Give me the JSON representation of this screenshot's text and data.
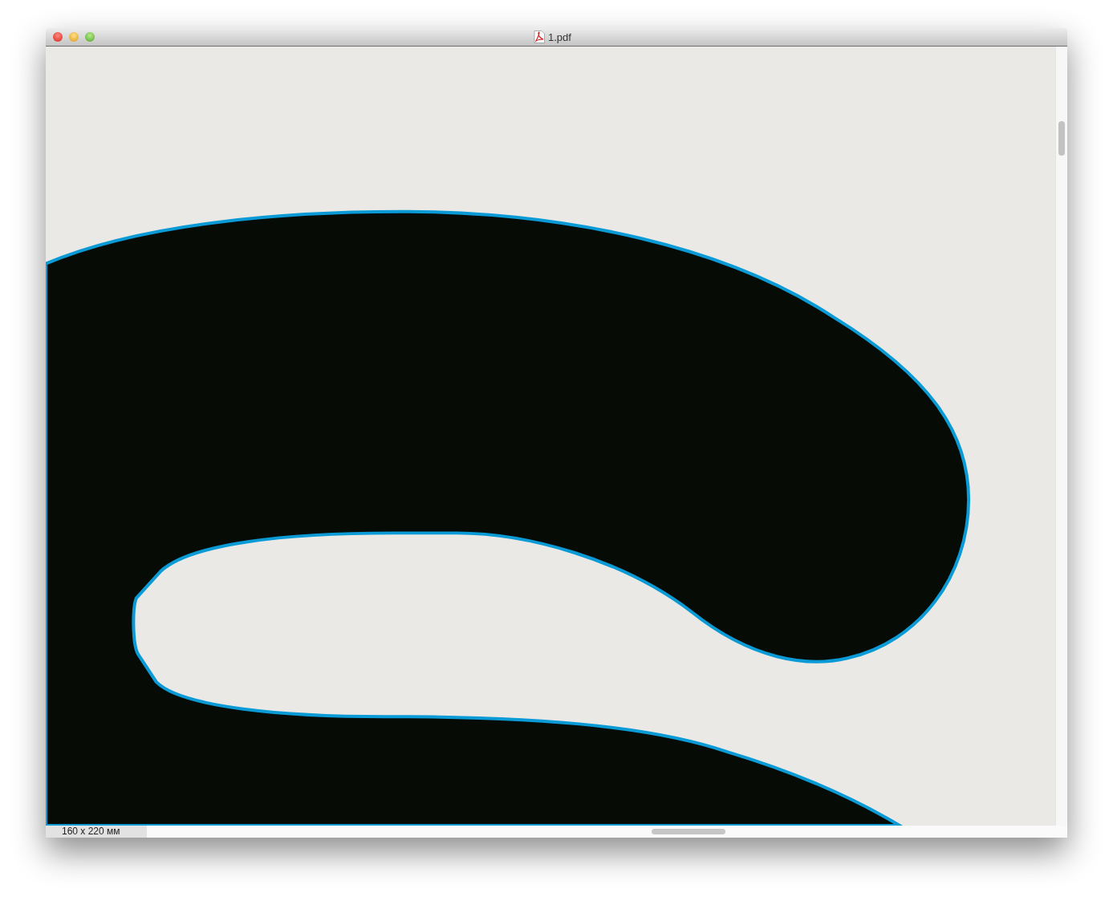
{
  "window": {
    "title": "1.pdf"
  },
  "status_bar": {
    "page_size": "160 x 220 мм"
  }
}
